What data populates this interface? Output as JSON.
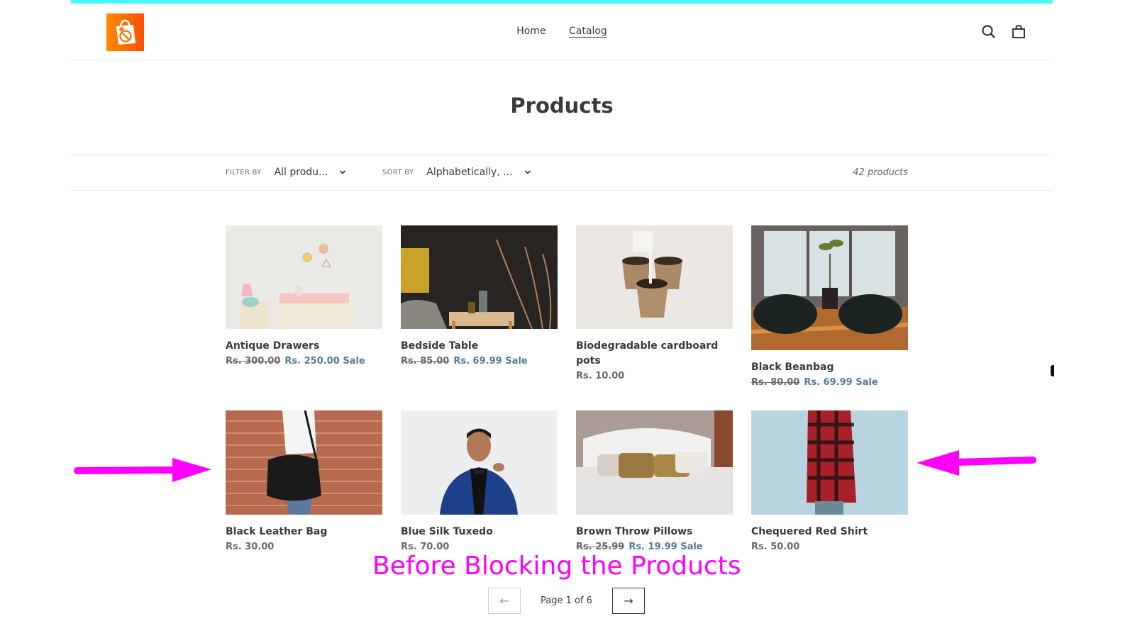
{
  "header": {
    "logo_icon": "shopping-bag-blocked-icon",
    "nav": [
      {
        "label": "Home",
        "active": false
      },
      {
        "label": "Catalog",
        "active": true
      }
    ],
    "icons": [
      "search-icon",
      "cart-icon"
    ]
  },
  "title": "Products",
  "filters": {
    "filter_label": "FILTER BY",
    "filter_value": "All produ...",
    "sort_label": "SORT BY",
    "sort_value": "Alphabetically, ...",
    "count": "42 products"
  },
  "products": [
    {
      "name": "Antique Drawers",
      "old_price": "Rs. 300.00",
      "price": "Rs. 250.00",
      "sale_label": "Sale"
    },
    {
      "name": "Bedside Table",
      "old_price": "Rs. 85.00",
      "price": "Rs. 69.99",
      "sale_label": "Sale"
    },
    {
      "name": "Biodegradable cardboard pots",
      "price": "Rs. 10.00"
    },
    {
      "name": "Black Beanbag",
      "old_price": "Rs. 80.00",
      "price": "Rs. 69.99",
      "sale_label": "Sale"
    },
    {
      "name": "Black Leather Bag",
      "price": "Rs. 30.00"
    },
    {
      "name": "Blue Silk Tuxedo",
      "price": "Rs. 70.00"
    },
    {
      "name": "Brown Throw Pillows",
      "old_price": "Rs. 25.99",
      "price": "Rs. 19.99",
      "sale_label": "Sale"
    },
    {
      "name": "Chequered Red Shirt",
      "price": "Rs. 50.00"
    }
  ],
  "pagination": {
    "prev": "←",
    "text": "Page 1 of 6",
    "next": "→"
  },
  "annotation": {
    "text": "Before Blocking the Products",
    "color": "#ff00ff"
  },
  "colors": {
    "accent_top": "#44fbf9",
    "sale": "#557b97",
    "logo": "#ff6a00"
  }
}
